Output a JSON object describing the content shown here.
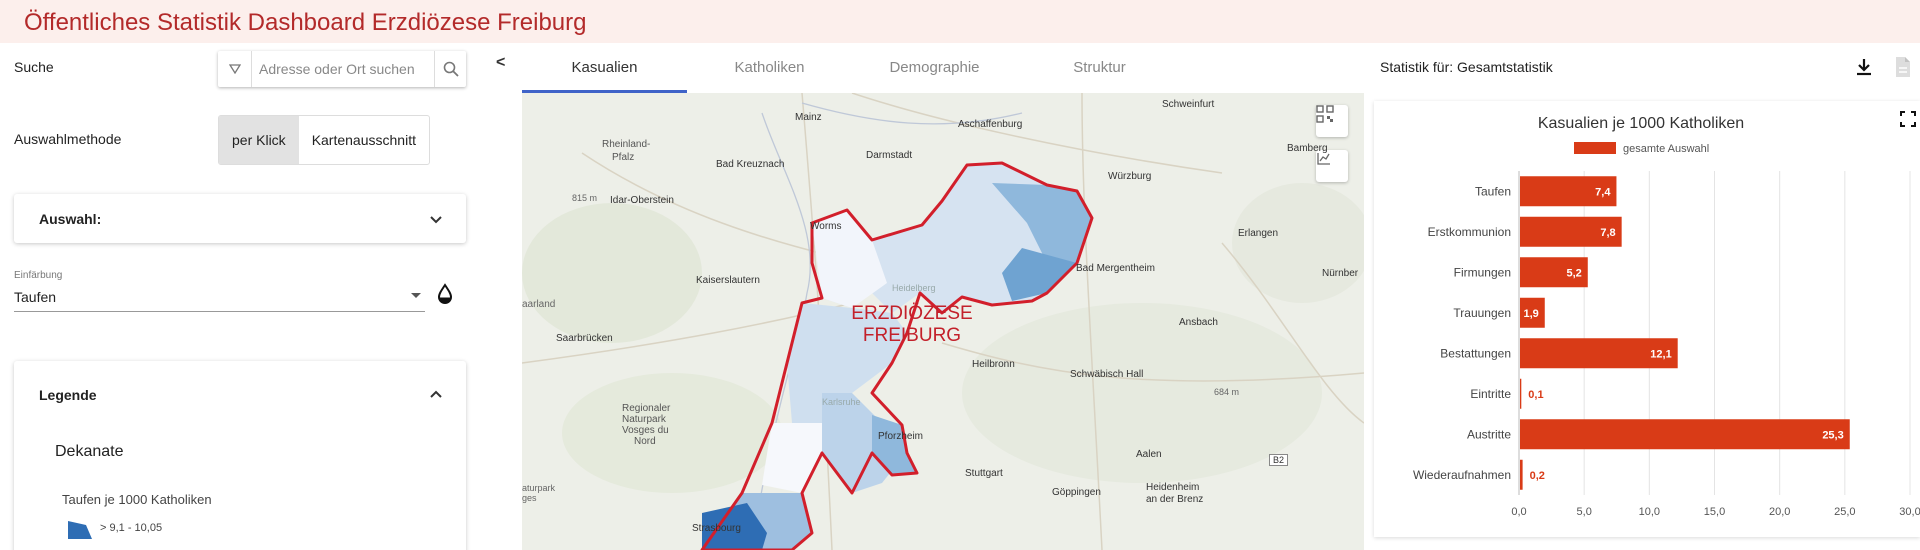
{
  "header": {
    "title": "Öffentliches Statistik Dashboard Erzdiözese Freiburg"
  },
  "left": {
    "search_label": "Suche",
    "search_placeholder": "Adresse oder Ort suchen",
    "method_label": "Auswahlmethode",
    "method_options": [
      "per Klick",
      "Kartenausschnitt"
    ],
    "method_selected": "per Klick",
    "selection_title": "Auswahl:",
    "coloring_label": "Einfärbung",
    "coloring_value": "Taufen",
    "legend_title": "Legende",
    "legend_group": "Dekanate",
    "legend_subtitle": "Taufen je 1000 Katholiken",
    "legend_item": "> 9,1 - 10,05"
  },
  "tabs": [
    "Kasualien",
    "Katholiken",
    "Demographie",
    "Struktur"
  ],
  "active_tab": "Kasualien",
  "map": {
    "diocese_label_1": "ERZDIÖZESE",
    "diocese_label_2": "FREIBURG",
    "cities": [
      "Mainz",
      "Aschaffenburg",
      "Schweinfurt",
      "Rheinland-",
      "Pfalz",
      "Bad Kreuznach",
      "Darmstadt",
      "Würzburg",
      "Bamberg",
      "Idar-Oberstein",
      "Worms",
      "Erlangen",
      "Bad Mergentheim",
      "Nürnber",
      "Kaiserslautern",
      "Heidelberg",
      "aarland",
      "Saarbrücken",
      "Ansbach",
      "Heilbronn",
      "Schwäbisch Hall",
      "Regionaler",
      "Naturpark",
      "Vosges du",
      "Nord",
      "Karlsruhe",
      "Pforzheim",
      "Aalen",
      "Stuttgart",
      "Göppingen",
      "Heidenheim",
      "an der Brenz",
      "Strasbourg",
      "aturpark",
      "ges"
    ],
    "elevations": [
      "815 m",
      "684 m"
    ],
    "road": "B2"
  },
  "right": {
    "stat_label": "Statistik für: Gesamtstatistik"
  },
  "chart_data": {
    "type": "bar",
    "orientation": "horizontal",
    "title": "Kasualien je 1000 Katholiken",
    "legend": "gesamte Auswahl",
    "legend_position": "top",
    "color": "#d93b17",
    "categories": [
      "Taufen",
      "Erstkommunion",
      "Firmungen",
      "Trauungen",
      "Bestattungen",
      "Eintritte",
      "Austritte",
      "Wiederaufnahmen"
    ],
    "values": [
      7.4,
      7.8,
      5.2,
      1.9,
      12.1,
      0.1,
      25.3,
      0.2
    ],
    "value_labels": [
      "7,4",
      "7,8",
      "5,2",
      "1,9",
      "12,1",
      "0,1",
      "25,3",
      "0,2"
    ],
    "xlim": [
      0,
      30
    ],
    "xticks": [
      "0,0",
      "5,0",
      "10,0",
      "15,0",
      "20,0",
      "25,0",
      "30,0"
    ],
    "grid": true
  },
  "colors": {
    "accent_red": "#b32a2a",
    "bar": "#d93b17",
    "tab_underline": "#3f63c8",
    "diocese_border": "#d21f2b"
  }
}
